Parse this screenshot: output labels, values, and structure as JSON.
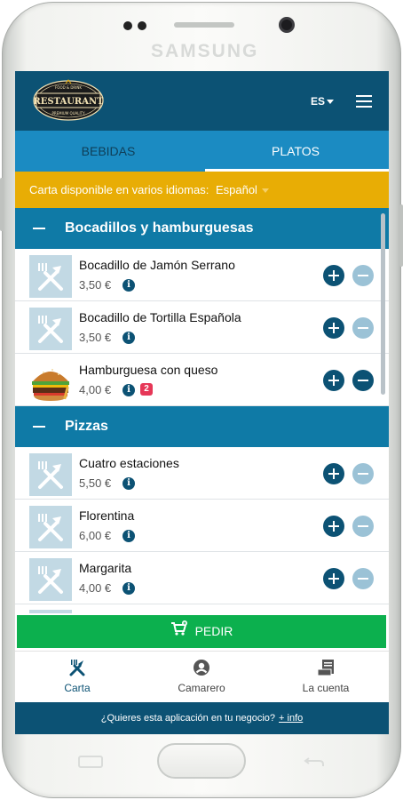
{
  "device": {
    "brand": "SAMSUNG"
  },
  "header": {
    "logo_top": "FOOD & DRINK",
    "logo_main": "RESTAURANT",
    "logo_bottom": "PREMIUM QUALITY",
    "language": "ES"
  },
  "tabs": [
    {
      "label": "BEBIDAS",
      "active": false
    },
    {
      "label": "PLATOS",
      "active": true
    }
  ],
  "notice": {
    "text": "Carta disponible en varios idiomas:",
    "selected_language": "Español"
  },
  "categories": [
    {
      "title": "Bocadillos y hamburguesas",
      "items": [
        {
          "name": "Bocadillo de Jamón Serrano",
          "price": "3,50 €",
          "image": "cutlery-placeholder-icon"
        },
        {
          "name": "Bocadillo de Tortilla Española",
          "price": "3,50 €",
          "image": "cutlery-placeholder-icon"
        },
        {
          "name": "Hamburguesa con queso",
          "price": "4,00 €",
          "image": "burger-photo",
          "quantity": "2"
        }
      ]
    },
    {
      "title": "Pizzas",
      "items": [
        {
          "name": "Cuatro estaciones",
          "price": "5,50 €",
          "image": "cutlery-placeholder-icon"
        },
        {
          "name": "Florentina",
          "price": "6,00 €",
          "image": "cutlery-placeholder-icon"
        },
        {
          "name": "Margarita",
          "price": "4,00 €",
          "image": "cutlery-placeholder-icon"
        }
      ]
    }
  ],
  "order_button": {
    "label": "PEDIR"
  },
  "bottom_nav": [
    {
      "label": "Carta",
      "icon": "cutlery-icon",
      "active": true
    },
    {
      "label": "Camarero",
      "icon": "user-icon",
      "active": false
    },
    {
      "label": "La cuenta",
      "icon": "receipt-icon",
      "active": false
    }
  ],
  "footer": {
    "text": "¿Quieres esta aplicación en tu negocio?",
    "link": "+ info"
  },
  "colors": {
    "header": "#0c5274",
    "tabs": "#1b8bc2",
    "notice": "#e8ad05",
    "category": "#0f7aa6",
    "order": "#0cb04e",
    "badge": "#e63757"
  }
}
